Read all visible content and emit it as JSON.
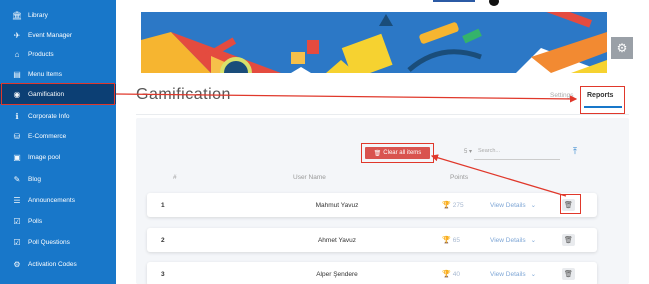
{
  "sidebar": {
    "items": [
      {
        "label": "Library",
        "icon": "library-icon",
        "glyph": "🏛"
      },
      {
        "label": "Event Manager",
        "icon": "event-manager-icon",
        "glyph": "✈"
      },
      {
        "label": "Products",
        "icon": "products-icon",
        "glyph": "⌂"
      },
      {
        "label": "Menu Items",
        "icon": "menu-items-icon",
        "glyph": "▤"
      },
      {
        "label": "Gamification",
        "icon": "gamification-icon",
        "glyph": "◉",
        "active": true
      },
      {
        "label": "Corporate Info",
        "icon": "info-icon",
        "glyph": "ℹ"
      },
      {
        "label": "E-Commerce",
        "icon": "ecommerce-icon",
        "glyph": "⛁"
      },
      {
        "label": "Image pool",
        "icon": "image-pool-icon",
        "glyph": "▣"
      },
      {
        "label": "Blog",
        "icon": "blog-icon",
        "glyph": "✎"
      },
      {
        "label": "Announcements",
        "icon": "announcements-icon",
        "glyph": "☰"
      },
      {
        "label": "Polls",
        "icon": "polls-icon",
        "glyph": "☑"
      },
      {
        "label": "Poll Questions",
        "icon": "poll-questions-icon",
        "glyph": "☑"
      },
      {
        "label": "Activation Codes",
        "icon": "activation-codes-icon",
        "glyph": "⚙"
      }
    ]
  },
  "header": {
    "title": "Gamification",
    "tabs": {
      "settings": "Settings",
      "reports": "Reports"
    }
  },
  "toolbar": {
    "clear_label": "Clear all items",
    "page_size": "5",
    "search_placeholder": "Search..."
  },
  "table": {
    "columns": {
      "index": "#",
      "user": "User Name",
      "points": "Points"
    },
    "rows": [
      {
        "index": "1",
        "name": "Mahmut Yavuz",
        "points": "275",
        "action": "View Details"
      },
      {
        "index": "2",
        "name": "Ahmet Yavuz",
        "points": "65",
        "action": "View Details"
      },
      {
        "index": "3",
        "name": "Alper Şendere",
        "points": "40",
        "action": "View Details"
      }
    ]
  },
  "colors": {
    "sidebar": "#1877c9",
    "sidebar_active": "#0c3f74",
    "danger": "#d9534f",
    "annotation": "#e0382b"
  }
}
